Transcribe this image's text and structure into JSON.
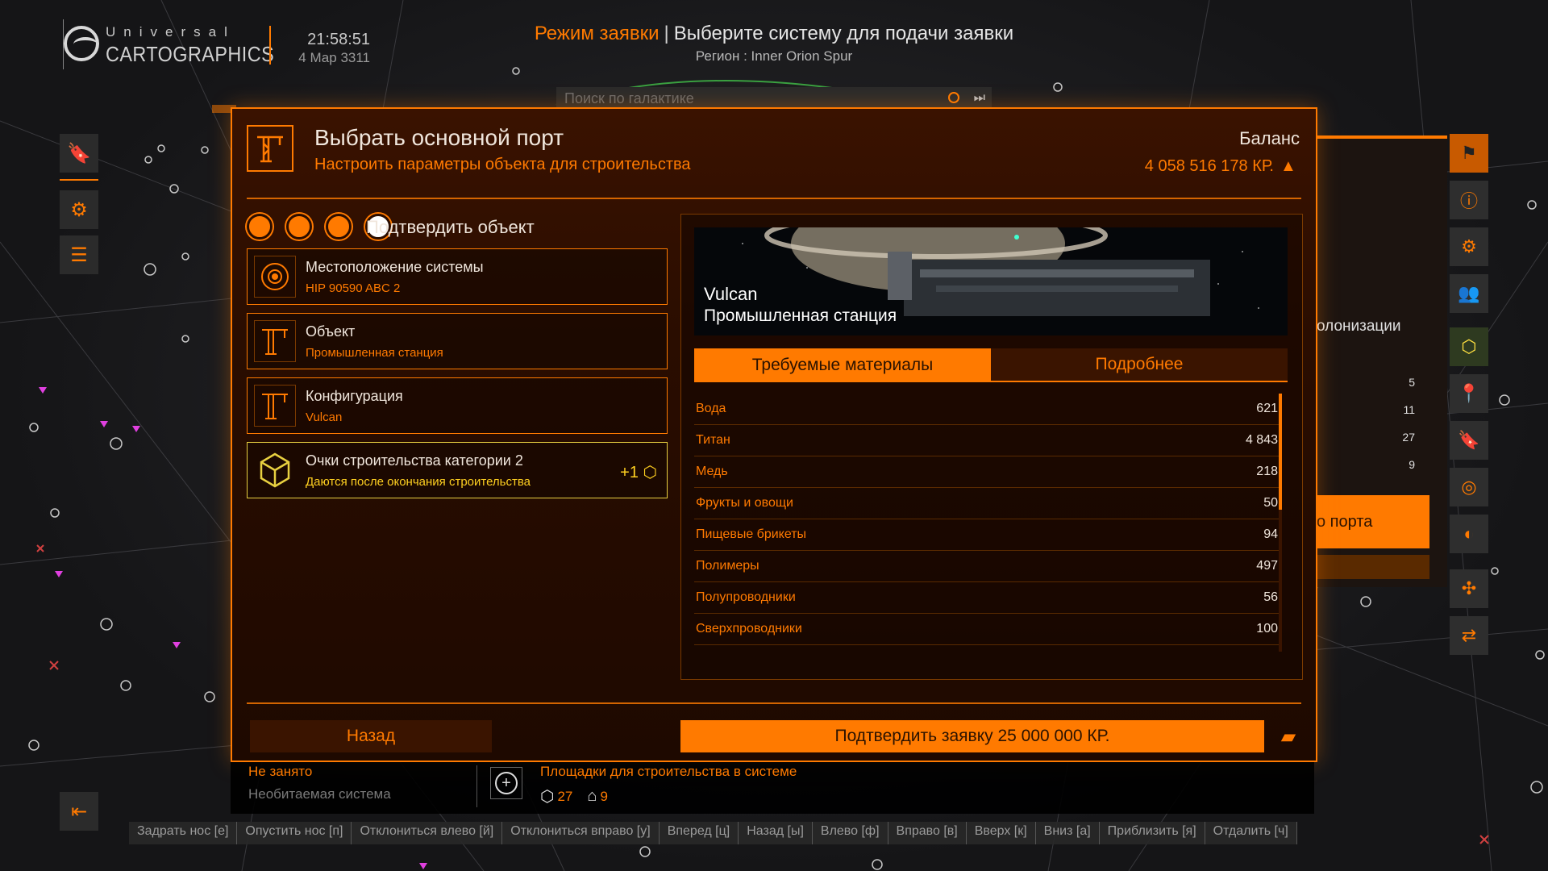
{
  "header": {
    "logo_top": "Universal",
    "logo_bottom": "CARTOGRAPHICS",
    "time": "21:58:51",
    "date": "4 Мар 3311",
    "mode": "Режим заявки",
    "separator": "|",
    "system_prompt": "Выберите систему для подачи заявки",
    "region": "Регион : Inner Orion Spur",
    "search_placeholder": "Поиск по галактике"
  },
  "left_sidebar": {
    "icons": [
      "bookmark-icon",
      "gear-icon",
      "list-icon"
    ],
    "exit_icon": "exit-icon"
  },
  "right_sidebar": {
    "icons": [
      "flag-icon",
      "info-icon",
      "settings-icon",
      "users-icon",
      "route-icon",
      "pin-icon",
      "bookmark-icon",
      "target-icon",
      "globe-icon",
      "network-icon",
      "swap-icon"
    ]
  },
  "bg_panel": {
    "text": "олонизации",
    "nums": [
      "5",
      "11",
      "27",
      "9"
    ],
    "button": "о порта"
  },
  "dialog": {
    "title": "Выбрать основной порт",
    "subtitle": "Настроить параметры объекта для строительства",
    "balance_label": "Баланс",
    "balance_value": "4 058 516 178 КР.",
    "step_label": "Подтвердить объект",
    "cards": [
      {
        "title": "Местоположение системы",
        "sub": "HIP 90590 ABC 2"
      },
      {
        "title": "Объект",
        "sub": "Промышленная станция"
      },
      {
        "title": "Конфигурация",
        "sub": "Vulcan"
      }
    ],
    "bonus_card": {
      "title": "Очки строительства категории 2",
      "sub": "Даются после окончания строительства",
      "bonus": "+1"
    },
    "station": {
      "name": "Vulcan",
      "type": "Промышленная станция"
    },
    "tabs": [
      "Требуемые материалы",
      "Подробнее"
    ],
    "materials": [
      {
        "name": "Вода",
        "qty": "621"
      },
      {
        "name": "Титан",
        "qty": "4 843"
      },
      {
        "name": "Медь",
        "qty": "218"
      },
      {
        "name": "Фрукты и овощи",
        "qty": "50"
      },
      {
        "name": "Пищевые брикеты",
        "qty": "94"
      },
      {
        "name": "Полимеры",
        "qty": "497"
      },
      {
        "name": "Полупроводники",
        "qty": "56"
      },
      {
        "name": "Сверхпроводники",
        "qty": "100"
      }
    ],
    "back": "Назад",
    "confirm": "Подтвердить заявку 25 000 000 КР."
  },
  "info_bar": {
    "status": "Не занято",
    "system": "Необитаемая система",
    "title": "Площадки для строительства в системе",
    "count_a": "27",
    "count_b": "9"
  },
  "keybinds": [
    "Задрать нос [е]",
    "Опустить нос [п]",
    "Отклониться влево [й]",
    "Отклониться вправо [у]",
    "Вперед [ц]",
    "Назад [ы]",
    "Влево [ф]",
    "Вправо [в]",
    "Вверх [к]",
    "Вниз [а]",
    "Приблизить [я]",
    "Отдалить [ч]"
  ],
  "colors": {
    "accent": "#ff7a00",
    "dialog_bg": "#2a0d00",
    "bonus": "#ffd020"
  }
}
